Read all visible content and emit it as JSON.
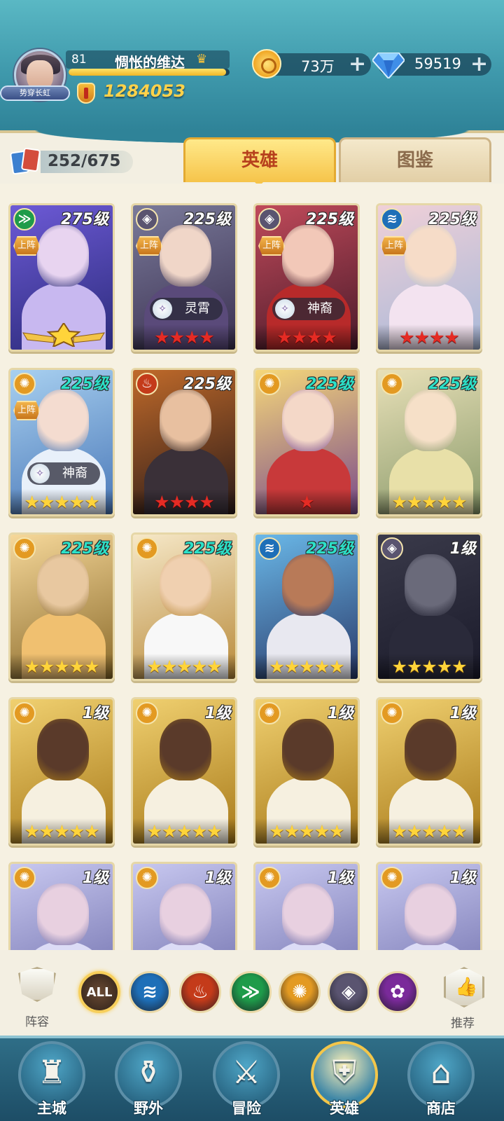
{
  "player": {
    "level": "81",
    "name": "惆怅的维达",
    "title_badge": "势穿长虹",
    "xp_fraction": 0.98,
    "power": "1284053"
  },
  "resources": {
    "gold": "73万",
    "gems": "59519",
    "add_symbol": "+"
  },
  "collection": {
    "count": "252/675"
  },
  "tabs": {
    "heroes": "英雄",
    "handbook": "图鉴"
  },
  "heroes": [
    {
      "level": "275级",
      "element": "wind",
      "deployed": true,
      "tag": "",
      "stars": 1,
      "star_color": "gold",
      "emblem": true,
      "level_color": "white"
    },
    {
      "level": "225级",
      "element": "shadow",
      "deployed": true,
      "tag": "灵霄",
      "stars": 4,
      "star_color": "red",
      "level_color": "white"
    },
    {
      "level": "225级",
      "element": "shadow",
      "deployed": true,
      "tag": "神裔",
      "stars": 4,
      "star_color": "red",
      "level_color": "white"
    },
    {
      "level": "225级",
      "element": "water",
      "deployed": true,
      "tag": "",
      "stars": 4,
      "star_color": "red",
      "level_color": "white"
    },
    {
      "level": "225级",
      "element": "light",
      "deployed": true,
      "tag": "神裔",
      "stars": 5,
      "star_color": "gold",
      "level_color": "teal"
    },
    {
      "level": "225级",
      "element": "fire",
      "deployed": false,
      "tag": "",
      "stars": 4,
      "star_color": "red",
      "level_color": "white"
    },
    {
      "level": "225级",
      "element": "light",
      "deployed": false,
      "tag": "",
      "stars": 1,
      "star_color": "red",
      "level_color": "teal"
    },
    {
      "level": "225级",
      "element": "light",
      "deployed": false,
      "tag": "",
      "stars": 5,
      "star_color": "gold",
      "level_color": "teal"
    },
    {
      "level": "225级",
      "element": "light",
      "deployed": false,
      "tag": "",
      "stars": 5,
      "star_color": "gold",
      "level_color": "teal"
    },
    {
      "level": "225级",
      "element": "light",
      "deployed": false,
      "tag": "",
      "stars": 5,
      "star_color": "gold",
      "level_color": "teal"
    },
    {
      "level": "225级",
      "element": "water",
      "deployed": false,
      "tag": "",
      "stars": 5,
      "star_color": "gold",
      "level_color": "teal"
    },
    {
      "level": "1级",
      "element": "shadow",
      "deployed": false,
      "tag": "",
      "stars": 5,
      "star_color": "gold",
      "level_color": "white"
    },
    {
      "level": "1级",
      "element": "light",
      "deployed": false,
      "tag": "",
      "stars": 5,
      "star_color": "gold",
      "level_color": "white"
    },
    {
      "level": "1级",
      "element": "light",
      "deployed": false,
      "tag": "",
      "stars": 5,
      "star_color": "gold",
      "level_color": "white"
    },
    {
      "level": "1级",
      "element": "light",
      "deployed": false,
      "tag": "",
      "stars": 5,
      "star_color": "gold",
      "level_color": "white"
    },
    {
      "level": "1级",
      "element": "light",
      "deployed": false,
      "tag": "",
      "stars": 5,
      "star_color": "gold",
      "level_color": "white"
    },
    {
      "level": "1级",
      "element": "light",
      "deployed": false,
      "tag": "",
      "stars": 0,
      "star_color": "gold",
      "level_color": "white"
    },
    {
      "level": "1级",
      "element": "light",
      "deployed": false,
      "tag": "",
      "stars": 0,
      "star_color": "gold",
      "level_color": "white"
    },
    {
      "level": "1级",
      "element": "light",
      "deployed": false,
      "tag": "",
      "stars": 0,
      "star_color": "gold",
      "level_color": "white"
    },
    {
      "level": "1级",
      "element": "light",
      "deployed": false,
      "tag": "",
      "stars": 0,
      "star_color": "gold",
      "level_color": "white"
    }
  ],
  "deploy_label": "上阵",
  "filters": {
    "lineup": "阵容",
    "all": "ALL",
    "elements": [
      "water",
      "fire",
      "wind",
      "light",
      "shadow",
      "void"
    ],
    "recommend": "推荐"
  },
  "nav": {
    "items": [
      "主城",
      "野外",
      "冒险",
      "英雄",
      "商店"
    ],
    "active_index": 3
  },
  "element_colors": {
    "water": "#1e6fb8",
    "fire": "#c43b1a",
    "wind": "#1f9b4a",
    "light": "#e39a22",
    "shadow": "#5a5470",
    "void": "#7a2a9a"
  }
}
